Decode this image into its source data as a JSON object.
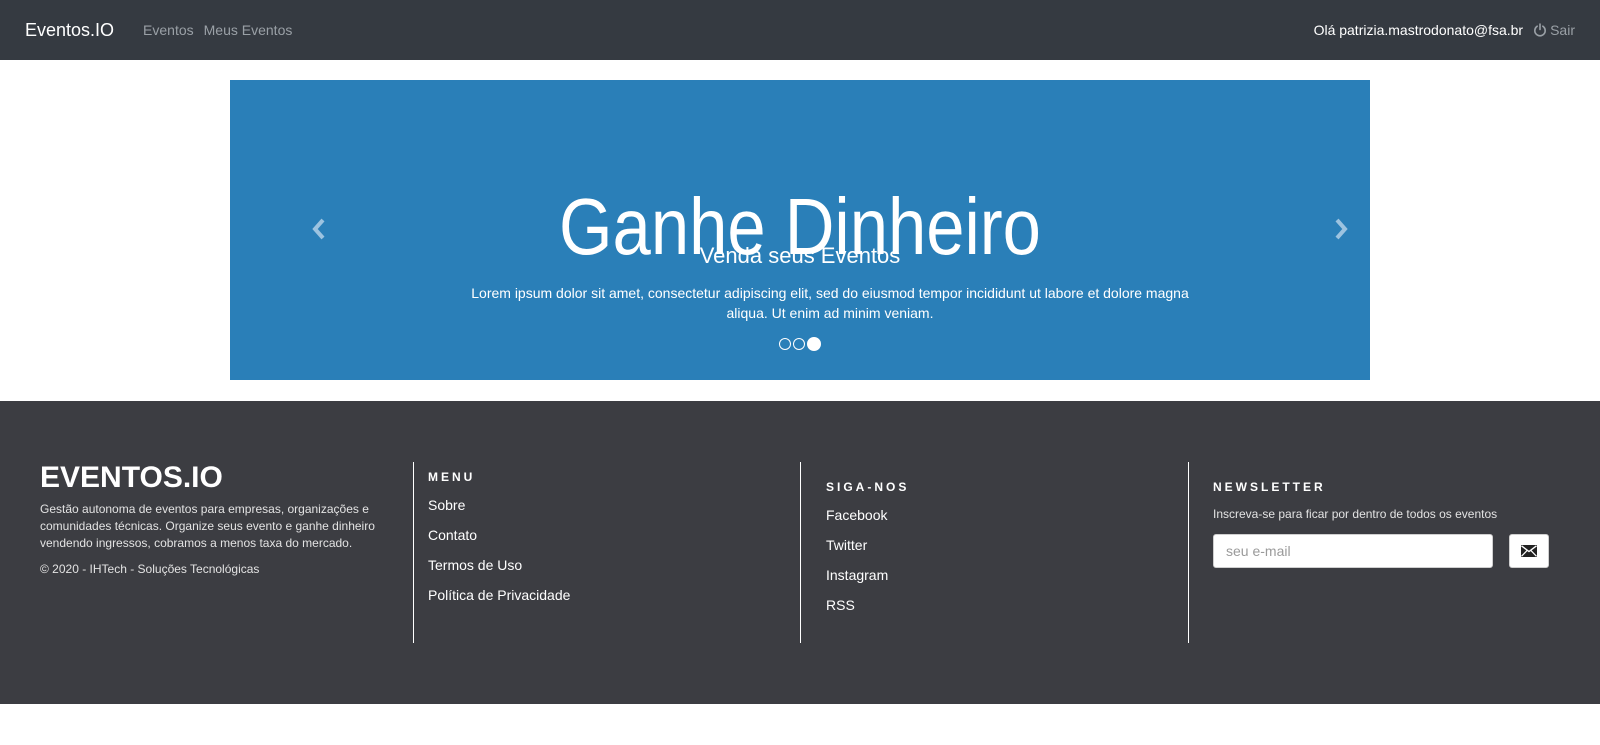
{
  "navbar": {
    "brand": "Eventos.IO",
    "links": [
      "Eventos",
      "Meus Eventos"
    ],
    "greeting": "Olá patrizia.mastrodonato@fsa.br",
    "logout_label": "Sair"
  },
  "carousel": {
    "background_color": "#2a7fb8",
    "big_text": "Ganhe Dinheiro",
    "caption": "Venda seus Eventos",
    "text": "Lorem ipsum dolor sit amet, consectetur adipiscing elit, sed do eiusmod tempor incididunt ut labore et dolore magna aliqua. Ut enim ad minim veniam.",
    "slide_count": 3,
    "active_slide": 3
  },
  "footer": {
    "background_color": "#3c3d42",
    "brand": "EVENTOS.IO",
    "description": "Gestão autonoma de eventos para empresas, organizações e comunidades técnicas. Organize seus evento e ganhe dinheiro vendendo ingressos, cobramos a menos taxa do mercado.",
    "copyright": "© 2020 - IHTech - Soluções Tecnológicas",
    "menu": {
      "heading": "MENU",
      "items": [
        "Sobre",
        "Contato",
        "Termos de Uso",
        "Política de Privacidade"
      ]
    },
    "follow": {
      "heading": "SIGA-NOS",
      "items": [
        "Facebook",
        "Twitter",
        "Instagram",
        "RSS"
      ]
    },
    "newsletter": {
      "heading": "NEWSLETTER",
      "text": "Inscreva-se para ficar por dentro de todos os eventos",
      "placeholder": "seu e-mail",
      "button_icon": "envelope-icon"
    }
  }
}
